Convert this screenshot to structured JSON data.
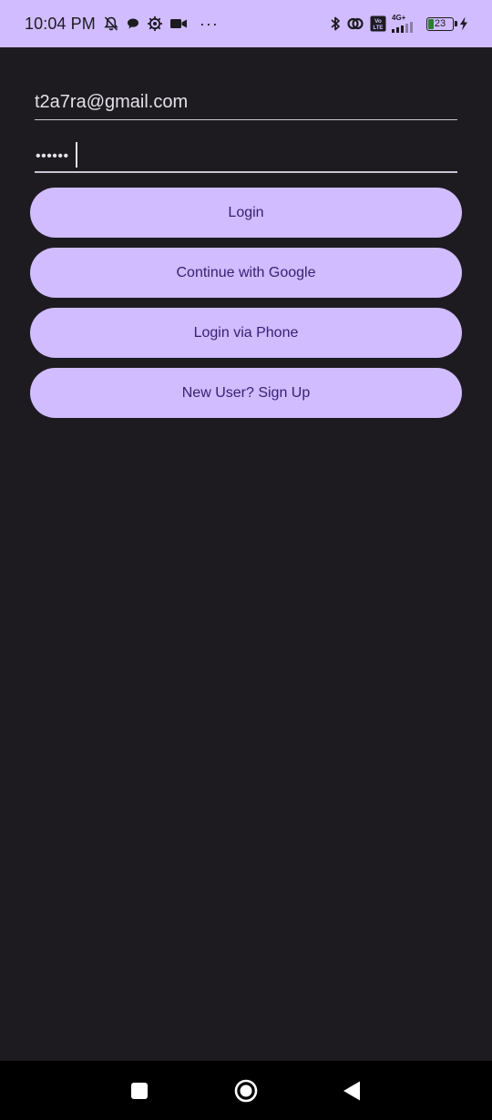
{
  "status_bar": {
    "time": "10:04 PM",
    "left_icons": [
      "bell-off-icon",
      "chat-bubble-icon",
      "settings-gear-icon",
      "video-camera-icon"
    ],
    "more": "···",
    "right_icons": [
      "bluetooth-icon",
      "hotspot-link-icon",
      "volte-icon",
      "signal-icon",
      "battery-icon",
      "charging-bolt-icon"
    ],
    "volte_label": "Vo LTE",
    "network_label": "4G+",
    "battery_level": "23"
  },
  "login_form": {
    "email_value": "t2a7ra@gmail.com",
    "password_mask": "••••••"
  },
  "buttons": {
    "login": "Login",
    "google": "Continue with Google",
    "phone": "Login via Phone",
    "signup": "New User? Sign Up"
  },
  "nav_bar": {
    "icons": [
      "recents-square-icon",
      "home-circle-icon",
      "back-triangle-icon"
    ]
  },
  "colors": {
    "accent": "#d0bcff",
    "on_accent": "#381e72",
    "background": "#1d1b20",
    "text": "#e6e0e9"
  }
}
